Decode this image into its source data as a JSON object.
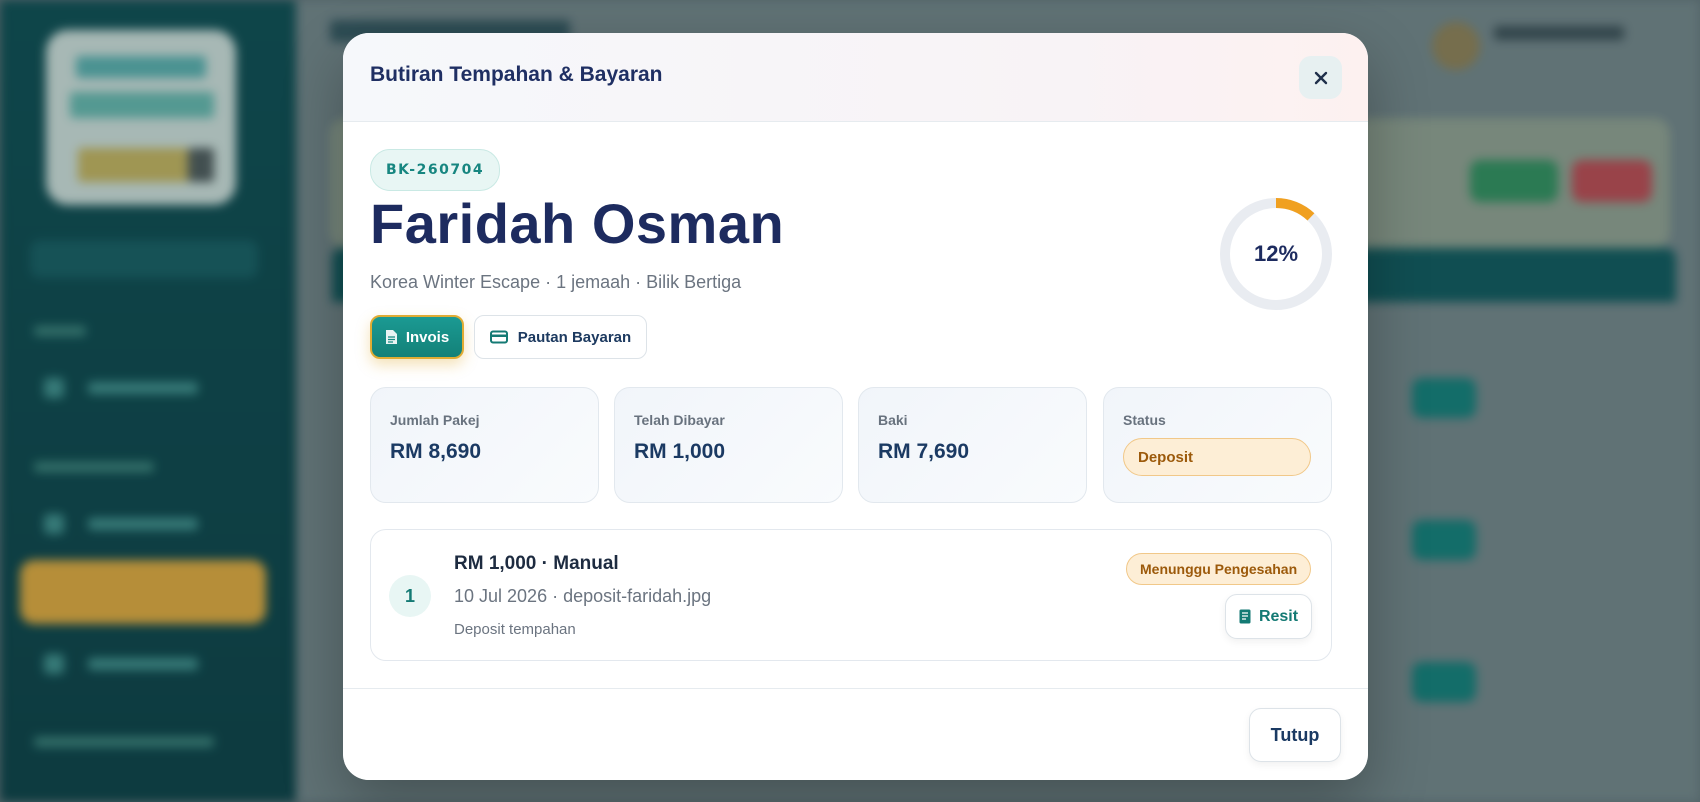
{
  "modal": {
    "title": "Butiran Tempahan & Bayaran",
    "close_icon": "close-icon"
  },
  "booking": {
    "code": "BK-260704",
    "customer_name": "Faridah Osman",
    "meta": "Korea Winter Escape · 1 jemaah · Bilik Bertiga",
    "progress_percent": 12,
    "progress_label": "12%"
  },
  "actions": {
    "invois_label": "Invois",
    "invois_icon": "document-icon",
    "pautan_label": "Pautan Bayaran",
    "pautan_icon": "credit-card-icon"
  },
  "stats": [
    {
      "label": "Jumlah Pakej",
      "value": "RM 8,690"
    },
    {
      "label": "Telah Dibayar",
      "value": "RM 1,000"
    },
    {
      "label": "Baki",
      "value": "RM 7,690"
    },
    {
      "label": "Status",
      "value": "Deposit"
    }
  ],
  "payments": [
    {
      "number": "1",
      "title": "RM 1,000 · Manual",
      "date_file": "10 Jul 2026 · deposit-faridah.jpg",
      "note": "Deposit tempahan",
      "status": "Menunggu Pengesahan",
      "resit_label": "Resit",
      "resit_icon": "receipt-icon"
    }
  ],
  "footer": {
    "tutup_label": "Tutup"
  },
  "colors": {
    "accent": "#178680",
    "title": "#1d2b5f",
    "progress": "#f0a020",
    "status_bg": "#fdeed6",
    "status_text": "#9c5a0b"
  }
}
